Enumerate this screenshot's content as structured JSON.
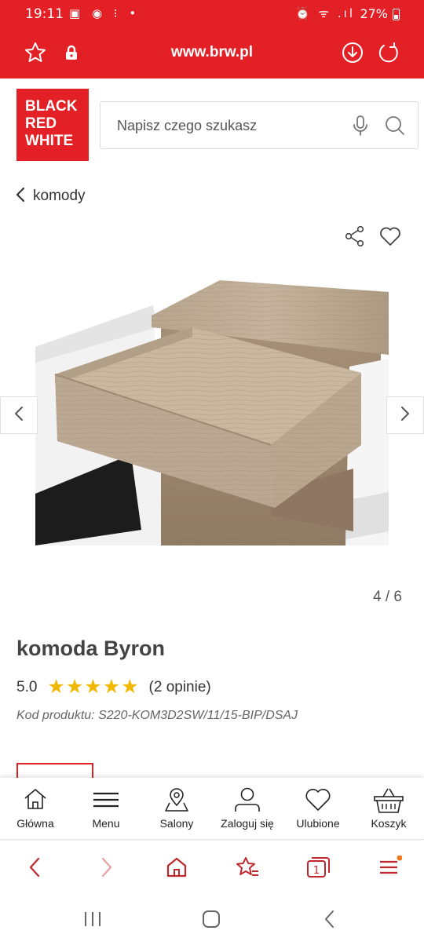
{
  "status_bar": {
    "time": "19:11",
    "left_icons": "▣ ◉ ⁝ •",
    "right_icons": "⏰ ᯤ .ıl",
    "battery": "27%"
  },
  "browser": {
    "url": "www.brw.pl",
    "icons": [
      "star-outline-icon",
      "lock-icon",
      "download-icon",
      "refresh-icon"
    ]
  },
  "logo": {
    "line1": "BLACK",
    "line2": "RED",
    "line3": "WHITE"
  },
  "search": {
    "placeholder": "Napisz czego szukasz"
  },
  "breadcrumb": {
    "label": "komody"
  },
  "gallery": {
    "counter": "4 / 6",
    "current": 4,
    "total": 6
  },
  "product": {
    "title": "komoda Byron",
    "rating_value": "5.0",
    "stars": 5,
    "reviews": "(2 opinie)",
    "code": "Kod produktu: S220-KOM3D2SW/11/15-BIP/DSAJ"
  },
  "site_nav": [
    {
      "label": "Główna",
      "icon": "home-icon"
    },
    {
      "label": "Menu",
      "icon": "hamburger-icon"
    },
    {
      "label": "Salony",
      "icon": "map-pin-icon"
    },
    {
      "label": "Zaloguj się",
      "icon": "user-icon"
    },
    {
      "label": "Ulubione",
      "icon": "heart-icon"
    },
    {
      "label": "Koszyk",
      "icon": "basket-icon"
    }
  ],
  "browser_toolbar": {
    "tabs_count": "1",
    "icons": [
      "back-icon",
      "forward-icon",
      "home-icon",
      "bookmarks-icon",
      "tabs-icon",
      "menu-icon"
    ]
  },
  "colors": {
    "brand": "#e32026",
    "star": "#f1b800"
  }
}
